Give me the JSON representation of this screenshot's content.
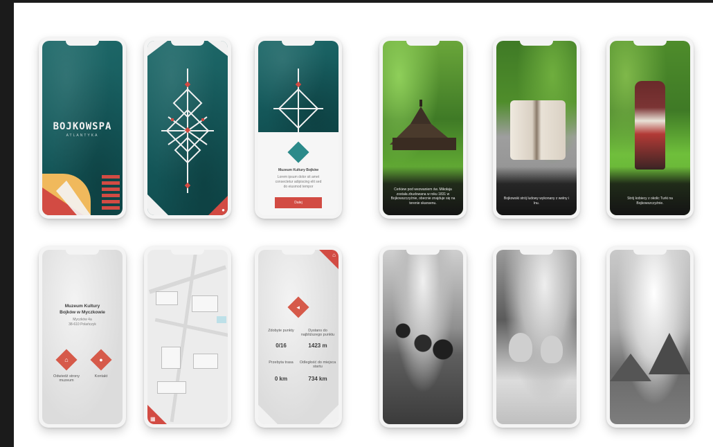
{
  "colors": {
    "accent": "#d24b43",
    "teal": "#155a5c"
  },
  "splash": {
    "logo": "BOJKOWSPA",
    "subtitle": "ATLANTYKA"
  },
  "info_card": {
    "title": "Muzeum Kultury Bojków",
    "line1": "Lorem ipsum dolor sit amet",
    "line2": "consectetur adipiscing elit sed",
    "line3": "do eiusmod tempor",
    "button": "Dalej"
  },
  "museum": {
    "title_line1": "Muzeum Kultury",
    "title_line2": "Bojków w Myczkowie",
    "sub1": "Myczków 4a",
    "sub2": "38-610 Polańczyk",
    "btn1_label": "Odwiedź strony muzeum",
    "btn2_label": "Kontakt",
    "btn1_icon": "home-icon",
    "btn2_icon": "pin-icon"
  },
  "stats": {
    "s1_label": "Zdobyte punkty",
    "s1_value": "0/16",
    "s2_label": "Dystans do najbliższego punktu",
    "s2_value": "1423 m",
    "s3_label": "Przebyta trasa",
    "s3_value": "0 km",
    "s4_label": "Odległość do miejsca startu",
    "s4_value": "734 km"
  },
  "captions": {
    "c1": "Cerkiew pod wezwaniem św. Mikołaja została zbudowana w roku 1831 w Bojkowszczyźnie, obecnie znajduje się na terenie skansenu.",
    "c2": "Bojkowski strój ludowy wykonany z wełny i lnu.",
    "c3": "Strój kobiecy z okolic Turki na Bojkowszczyźnie."
  }
}
